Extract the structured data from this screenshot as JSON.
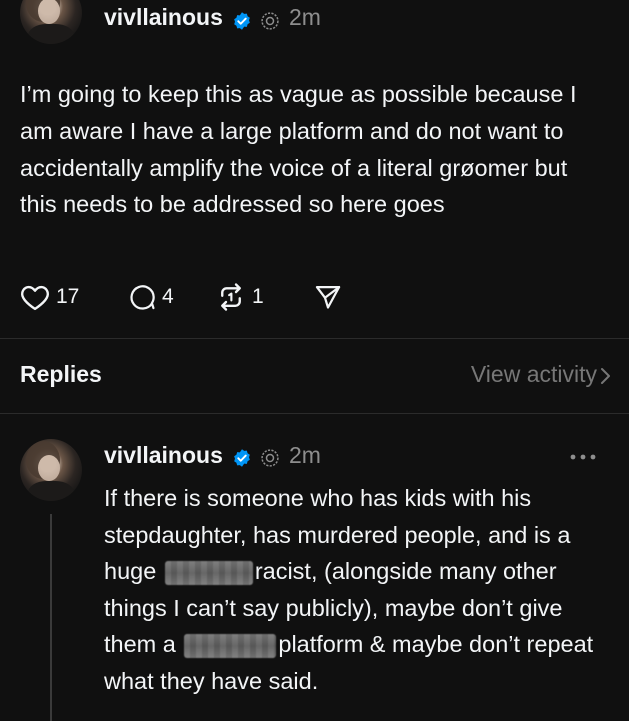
{
  "post": {
    "username": "vivllainous",
    "time": "2m",
    "text": "I’m going to keep this as vague as possible because I am aware I have a large platform and do not want to accidentally amplify the voice of a literal grøomer but this needs to be addressed so here goes",
    "likes": "17",
    "comments": "4",
    "reposts": "1"
  },
  "replies_section": {
    "label": "Replies",
    "view_activity": "View activity"
  },
  "reply": {
    "username": "vivllainous",
    "time": "2m",
    "text_part1": "If there is someone who has kids with his stepdaughter, has murdered people, and is a huge",
    "text_part2": "racist, (alongside many other things I can’t say publicly), maybe don’t give them a",
    "text_part3": "platform & maybe don’t repeat what they have said."
  },
  "colors": {
    "background": "#101010",
    "verified_blue": "#0095f6",
    "muted_text": "#8e8e8e"
  },
  "icons": {
    "like": "heart-icon",
    "comment": "comment-icon",
    "repost": "repost-icon",
    "share": "send-icon",
    "verified": "verified-badge-icon",
    "threads": "threads-icon",
    "more": "more-icon",
    "chevron": "chevron-right-icon"
  }
}
